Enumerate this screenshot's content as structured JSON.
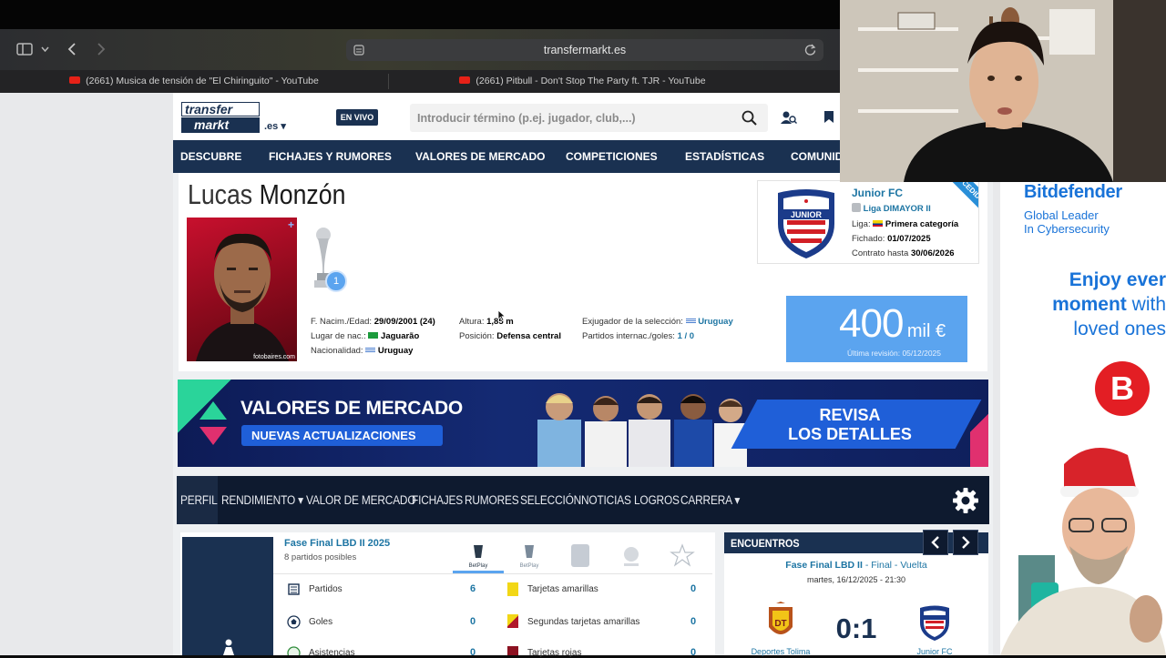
{
  "browser": {
    "url": "transfermarkt.es",
    "tabs": [
      "(2661) Musica de tensión de \"El Chiringuito\" - YouTube",
      "(2661) Pitbull - Don't Stop The Party ft. TJR - YouTube"
    ]
  },
  "site": {
    "logo_line1": "transfer",
    "logo_line2": "markt",
    "domain": ".es",
    "live_badge": "EN VIVO",
    "search_placeholder": "Introducir término (p.ej. jugador, club,...)",
    "nav": [
      "DESCUBRE",
      "FICHAJES Y RUMORES",
      "VALORES DE MERCADO",
      "COMPETICIONES",
      "ESTADÍSTICAS",
      "COMUNID"
    ]
  },
  "player": {
    "first_name": "Lucas",
    "last_name": "Monzón",
    "photo_credit": "fotobaires.com",
    "trophy_count": "1",
    "birth_label": "F. Nacim./Edad:",
    "birth_value": "29/09/2001 (24)",
    "birthplace_label": "Lugar de nac.:",
    "birthplace_value": "Jaguarão",
    "nationality_label": "Nacionalidad:",
    "nationality_value": "Uruguay",
    "height_label": "Altura:",
    "height_value": "1,85 m",
    "position_label": "Posición:",
    "position_value": "Defensa central",
    "former_national_label": "Exjugador de la selección:",
    "former_national_value": "Uruguay",
    "caps_label": "Partidos internac./goles:",
    "caps_value": "1 / 0"
  },
  "club": {
    "name": "Junior FC",
    "league": "Liga DIMAYOR II",
    "liga_label": "Liga:",
    "liga_value": "Primera categoría",
    "joined_label": "Fichado:",
    "joined_value": "01/07/2025",
    "contract_label": "Contrato hasta",
    "contract_value": "30/06/2026",
    "ribbon": "CEDIDO",
    "crest_text": "JUNIOR"
  },
  "market_value": {
    "amount": "400",
    "unit": "mil €",
    "revision": "Última revisión: 05/12/2025"
  },
  "banner": {
    "title": "VALORES DE MERCADO",
    "subtitle": "NUEVAS ACTUALIZACIONES",
    "cta_line1": "REVISA",
    "cta_line2": "LOS DETALLES"
  },
  "subnav": [
    "PERFIL",
    "RENDIMIENTO",
    "VALOR DE MERCADO",
    "FICHAJES",
    "RUMORES",
    "SELECCIÓN",
    "NOTICIAS",
    "LOGROS",
    "CARRERA"
  ],
  "stats": {
    "competition": "Fase Final LBD II 2025",
    "possible": "8 partidos posibles",
    "rows_left": [
      {
        "label": "Partidos",
        "value": "6"
      },
      {
        "label": "Goles",
        "value": "0"
      },
      {
        "label": "Asistencias",
        "value": "0"
      }
    ],
    "rows_right": [
      {
        "label": "Tarjetas amarillas",
        "value": "0"
      },
      {
        "label": "Segundas tarjetas amarillas",
        "value": "0"
      },
      {
        "label": "Tarjetas rojas",
        "value": "0"
      }
    ]
  },
  "matches": {
    "title": "ENCUENTROS",
    "competition": "Fase Final LBD II",
    "stage": "- Final - Vuelta",
    "date": "martes, 16/12/2025 - 21:30",
    "score": "0:1",
    "home": "Deportes Tolima",
    "away": "Junior FC",
    "home_crest": "DT"
  },
  "ad": {
    "brand": "Bitdefender",
    "tagline1": "Global Leader",
    "tagline2": "In Cybersecurity",
    "headline1": "Enjoy ever",
    "headline2_bold": "moment",
    "headline2_rest": " with",
    "headline3": "loved ones",
    "logo_letter": "B"
  },
  "colors": {
    "nav_blue": "#1a3151",
    "link_blue": "#1d75a3",
    "value_box": "#5ba4ef",
    "subnav": "#0e1a2f",
    "ad_blue": "#1973d8"
  }
}
